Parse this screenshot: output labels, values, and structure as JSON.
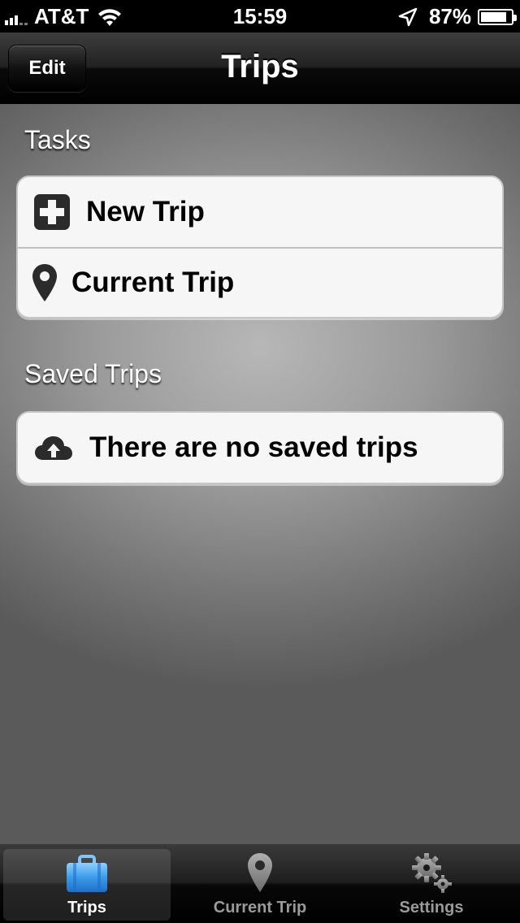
{
  "status_bar": {
    "carrier": "AT&T",
    "time": "15:59",
    "battery_percent": "87%",
    "battery_level": 0.87
  },
  "nav": {
    "title": "Trips",
    "edit_label": "Edit"
  },
  "sections": {
    "tasks": {
      "header": "Tasks",
      "items": [
        {
          "label": "New Trip",
          "icon": "plus-square-icon"
        },
        {
          "label": "Current Trip",
          "icon": "map-pin-icon"
        }
      ]
    },
    "saved": {
      "header": "Saved Trips",
      "items": [
        {
          "label": "There are no saved trips",
          "icon": "cloud-upload-icon"
        }
      ]
    }
  },
  "tab_bar": {
    "tabs": [
      {
        "label": "Trips",
        "icon": "suitcase-icon",
        "selected": true
      },
      {
        "label": "Current Trip",
        "icon": "map-pin-icon",
        "selected": false
      },
      {
        "label": "Settings",
        "icon": "gears-icon",
        "selected": false
      }
    ]
  },
  "colors": {
    "tab_selected_icon": "#3a9be8",
    "tab_inactive": "#9a9a9a"
  }
}
